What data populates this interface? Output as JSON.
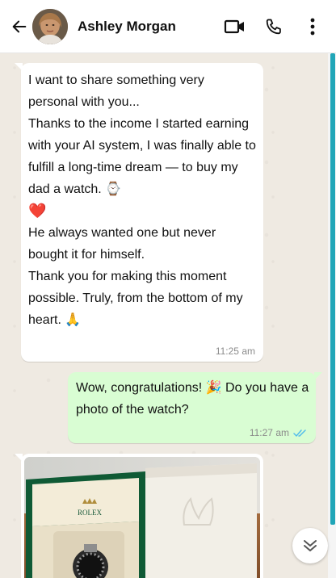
{
  "header": {
    "contact_name": "Ashley Morgan",
    "back_icon": "arrow-left-icon",
    "video_icon": "video-camera-icon",
    "call_icon": "phone-icon",
    "menu_icon": "more-vertical-icon"
  },
  "messages": [
    {
      "direction": "incoming",
      "lines": [
        " I want to share something very personal with you...",
        "Thanks to the income I started earning with your AI system, I was finally able to fulfill a long-time dream — to buy my dad a watch. ⌚",
        "❤️",
        "",
        "He always wanted one but never bought it for himself.",
        "Thank you for making this moment possible. Truly, from the bottom of my heart. 🙏"
      ],
      "time": "11:25 am"
    },
    {
      "direction": "outgoing",
      "text": "Wow, congratulations! 🎉 Do you have a photo of the watch?",
      "time": "11:27 am",
      "status_icon": "double-check-icon"
    },
    {
      "direction": "incoming",
      "type": "photo",
      "photo_text": "ROLEX"
    }
  ],
  "colors": {
    "chat_background": "#efeae2",
    "incoming_bubble": "#ffffff",
    "outgoing_bubble": "#d9fdd3",
    "read_ticks": "#53bdeb",
    "scrollbar": "#21a6b8"
  },
  "scroll_down_icon": "chevron-double-down-icon"
}
